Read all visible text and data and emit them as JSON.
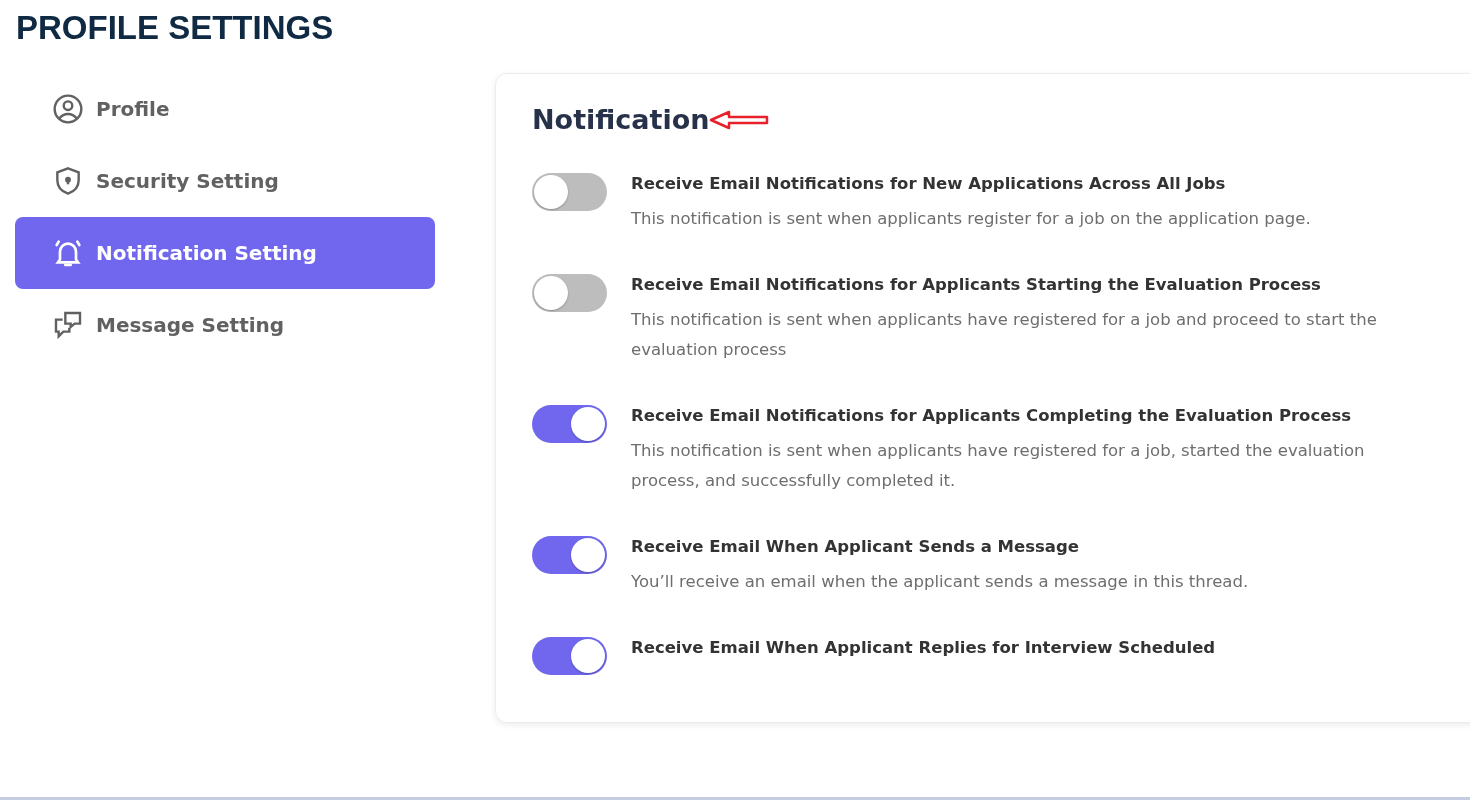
{
  "page_title": "PROFILE SETTINGS",
  "sidebar": {
    "items": [
      {
        "label": "Profile",
        "kind": "profile",
        "selected": false
      },
      {
        "label": "Security Setting",
        "kind": "security",
        "selected": false
      },
      {
        "label": "Notification Setting",
        "kind": "notification",
        "selected": true
      },
      {
        "label": "Message Setting",
        "kind": "message",
        "selected": false
      }
    ]
  },
  "panel": {
    "title": "Notification",
    "annotation_arrow": true,
    "settings": [
      {
        "title": "Receive Email Notifications for New Applications Across All Jobs",
        "description": "This notification is sent when applicants register for a job on the application page.",
        "on": false
      },
      {
        "title": "Receive Email Notifications for Applicants Starting the Evaluation Process",
        "description": "This notification is sent when applicants have registered for a job and proceed to start the evaluation process",
        "on": false
      },
      {
        "title": "Receive Email Notifications for Applicants Completing the Evaluation Process",
        "description": "This notification is sent when applicants have registered for a job, started the evaluation process, and successfully completed it.",
        "on": true
      },
      {
        "title": "Receive Email When Applicant Sends a Message",
        "description": "You’ll receive an email when the applicant sends a message in this thread.",
        "on": true
      },
      {
        "title": "Receive Email When Applicant Replies for Interview Scheduled",
        "on": true
      }
    ]
  }
}
